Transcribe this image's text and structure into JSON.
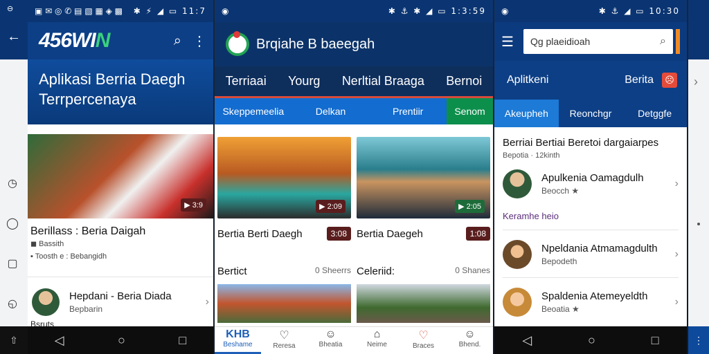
{
  "colors": {
    "brand_blue": "#0d3f86",
    "accent_green": "#39d27c",
    "accent_red": "#d84b3a",
    "badge": "#5a1d1d"
  },
  "phone1": {
    "status": {
      "left": "▣ ✉ ◎ ✆ ▤ ▧ ▦ ◈ ▩",
      "right": "✱ ⚡ ◢ ▭ 11:7"
    },
    "logo": {
      "main": "456WI",
      "accent": "N"
    },
    "hero_title": "Aplikasi Berria Daegh Terrpercenaya",
    "card": {
      "badge": "▶ 3:9",
      "title": "Berillass : Beria Daigah",
      "meta1": "◼ Bassith",
      "meta2": "▪ Toosth e : Bebangidh"
    },
    "row": {
      "title": "Hepdani - Beria Diada",
      "subtitle": "Bepbarin"
    },
    "bottom_partial": "Bsruts"
  },
  "phone2": {
    "status": {
      "left": "◉",
      "right": "✱ ⚓ ✱ ◢ ▭ 1:3:59"
    },
    "app_title": "Brqiahe B baeegah",
    "tabs": [
      "Terriaai",
      "Yourg",
      "Nerltial Braaga",
      "Bernoi"
    ],
    "subtabs": [
      "Skeppemeelia",
      "Delkan",
      "Prentiir",
      "Senom"
    ],
    "cards": [
      {
        "badge": "▶ 2:09",
        "title": "Bertia Berti Daegh",
        "pill": "3:08"
      },
      {
        "badge": "▶ 2:05",
        "title": "Bertia Daegeh",
        "pill": "1:08"
      }
    ],
    "sections": [
      {
        "title": "Bertict",
        "count": "0 Sheerrs"
      },
      {
        "title": "Celeriid:",
        "count": "0 Shanes"
      }
    ],
    "bottom_nav": [
      {
        "icon": "KHB",
        "label": "Beshame"
      },
      {
        "icon": "♡",
        "label": "Reresa"
      },
      {
        "icon": "☺",
        "label": "Bheatia"
      },
      {
        "icon": "⌂",
        "label": "Neime"
      },
      {
        "icon": "♡",
        "label": "Braces"
      },
      {
        "icon": "☺",
        "label": "Bhend."
      }
    ]
  },
  "phone3": {
    "status": {
      "left": "◉",
      "right": "✱ ⚓ ◢ ▭ 10:30"
    },
    "search": {
      "value": "Qg plaeidioah"
    },
    "header": {
      "title": "Aplitkeni",
      "right": "Berita"
    },
    "tabs": [
      "Akeupheh",
      "Reonchgr",
      "Detggfe"
    ],
    "headline": "Berriai Bertiai Beretoi dargaiarpes",
    "headline_sub": "Bepotia · 12kinth",
    "items": [
      {
        "title": "Apulkenia Oamagdulh",
        "sub": "Beocch ★"
      },
      {
        "title": "Npeldania Atmamagdulth",
        "sub": "Bepodeth"
      },
      {
        "title": "Spaldenia Atemeyeldth",
        "sub": "Beoatia ★"
      }
    ],
    "link": "Keramhe heio"
  },
  "left_rail": {
    "back": "←",
    "icons": [
      "◷",
      "◯",
      "▢",
      "◵"
    ],
    "bottom": "⇧"
  }
}
